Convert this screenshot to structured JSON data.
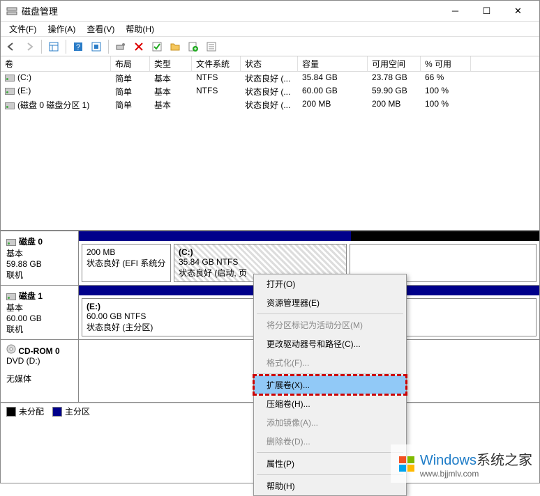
{
  "window": {
    "title": "磁盘管理"
  },
  "menubar": [
    "文件(F)",
    "操作(A)",
    "查看(V)",
    "帮助(H)"
  ],
  "columns": {
    "vol": "卷",
    "layout": "布局",
    "type": "类型",
    "fs": "文件系统",
    "status": "状态",
    "capacity": "容量",
    "free": "可用空间",
    "pct": "% 可用"
  },
  "rows": [
    {
      "vol": "(C:)",
      "layout": "简单",
      "type": "基本",
      "fs": "NTFS",
      "status": "状态良好 (...",
      "capacity": "35.84 GB",
      "free": "23.78 GB",
      "pct": "66 %"
    },
    {
      "vol": "(E:)",
      "layout": "简单",
      "type": "基本",
      "fs": "NTFS",
      "status": "状态良好 (...",
      "capacity": "60.00 GB",
      "free": "59.90 GB",
      "pct": "100 %"
    },
    {
      "vol": "(磁盘 0 磁盘分区 1)",
      "layout": "简单",
      "type": "基本",
      "fs": "",
      "status": "状态良好 (...",
      "capacity": "200 MB",
      "free": "200 MB",
      "pct": "100 %"
    }
  ],
  "disks": [
    {
      "name": "磁盘 0",
      "type": "基本",
      "size": "59.88 GB",
      "state": "联机",
      "parts": [
        {
          "title": "",
          "l1": "200 MB",
          "l2": "状态良好 (EFI 系统分"
        },
        {
          "title": "(C:)",
          "l1": "35.84 GB NTFS",
          "l2": "状态良好 (启动, 页"
        },
        {
          "title": "",
          "l1": "",
          "l2": ""
        }
      ]
    },
    {
      "name": "磁盘 1",
      "type": "基本",
      "size": "60.00 GB",
      "state": "联机",
      "parts": [
        {
          "title": "(E:)",
          "l1": "60.00 GB NTFS",
          "l2": "状态良好 (主分区)"
        }
      ]
    },
    {
      "name": "CD-ROM 0",
      "type": "DVD (D:)",
      "size": "",
      "state": "无媒体",
      "parts": []
    }
  ],
  "legend": {
    "unalloc": "未分配",
    "primary": "主分区"
  },
  "context": {
    "open": "打开(O)",
    "explorer": "资源管理器(E)",
    "mark_active": "将分区标记为活动分区(M)",
    "change_letter": "更改驱动器号和路径(C)...",
    "format": "格式化(F)...",
    "extend": "扩展卷(X)...",
    "shrink": "压缩卷(H)...",
    "add_mirror": "添加镜像(A)...",
    "delete": "删除卷(D)...",
    "properties": "属性(P)",
    "help": "帮助(H)"
  },
  "watermark": {
    "brand1": "Windows",
    "brand2": "系统之家",
    "url": "www.bjjmlv.com"
  }
}
